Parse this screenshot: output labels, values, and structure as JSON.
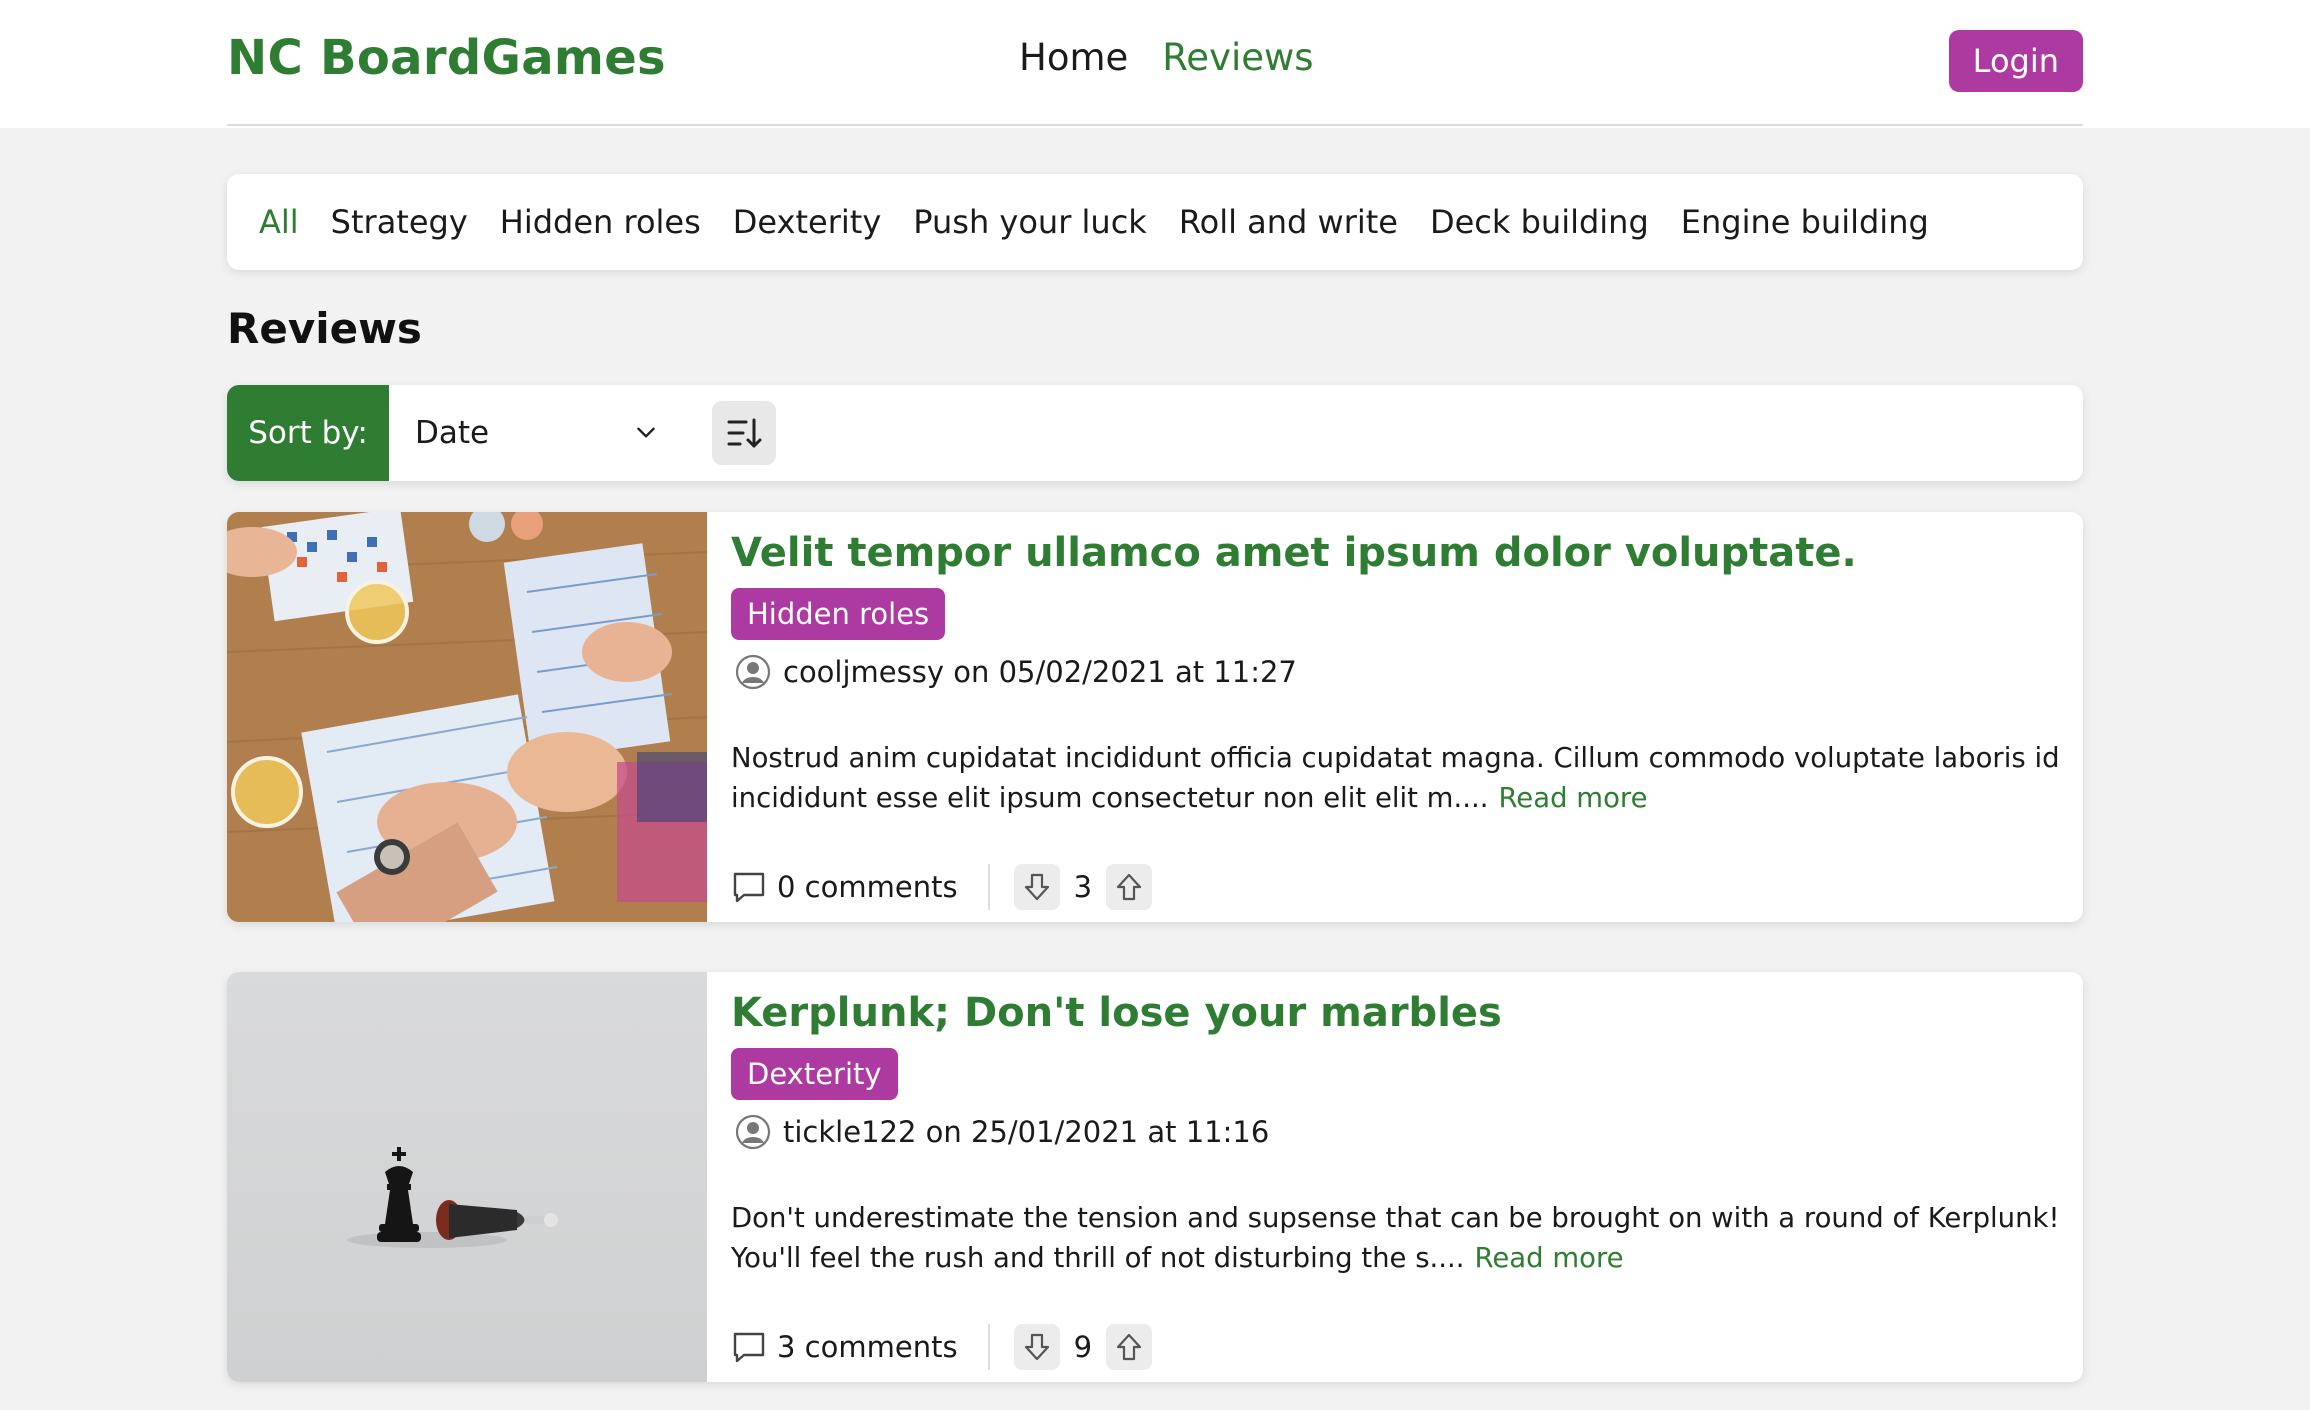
{
  "header": {
    "brand": "NC BoardGames",
    "nav": [
      {
        "label": "Home"
      },
      {
        "label": "Reviews"
      }
    ],
    "login_label": "Login"
  },
  "categories": [
    {
      "label": "All"
    },
    {
      "label": "Strategy"
    },
    {
      "label": "Hidden roles"
    },
    {
      "label": "Dexterity"
    },
    {
      "label": "Push your luck"
    },
    {
      "label": "Roll and write"
    },
    {
      "label": "Deck building"
    },
    {
      "label": "Engine building"
    }
  ],
  "reviews_heading": "Reviews",
  "sort": {
    "label": "Sort by:",
    "selected": "Date"
  },
  "reviews": [
    {
      "title": "Velit tempor ullamco amet ipsum dolor voluptate.",
      "category": "Hidden roles",
      "author_line": "cooljmessy on 05/02/2021 at 11:27",
      "excerpt": "Nostrud anim cupidatat incididunt officia cupidatat magna. Cillum commodo voluptate laboris id incididunt esse elit ipsum consectetur non elit elit m....",
      "read_more": "Read more",
      "comments": "0 comments",
      "votes": "3"
    },
    {
      "title": "Kerplunk; Don't lose your marbles",
      "category": "Dexterity",
      "author_line": "tickle122 on 25/01/2021 at 11:16",
      "excerpt": "Don't underestimate the tension and supsense that can be brought on with a round of Kerplunk! You'll feel the rush and thrill of not disturbing the s....",
      "read_more": "Read more",
      "comments": "3 comments",
      "votes": "9"
    }
  ],
  "colors": {
    "brand_green": "#2e7d32",
    "accent_purple": "#ad3aa0"
  }
}
